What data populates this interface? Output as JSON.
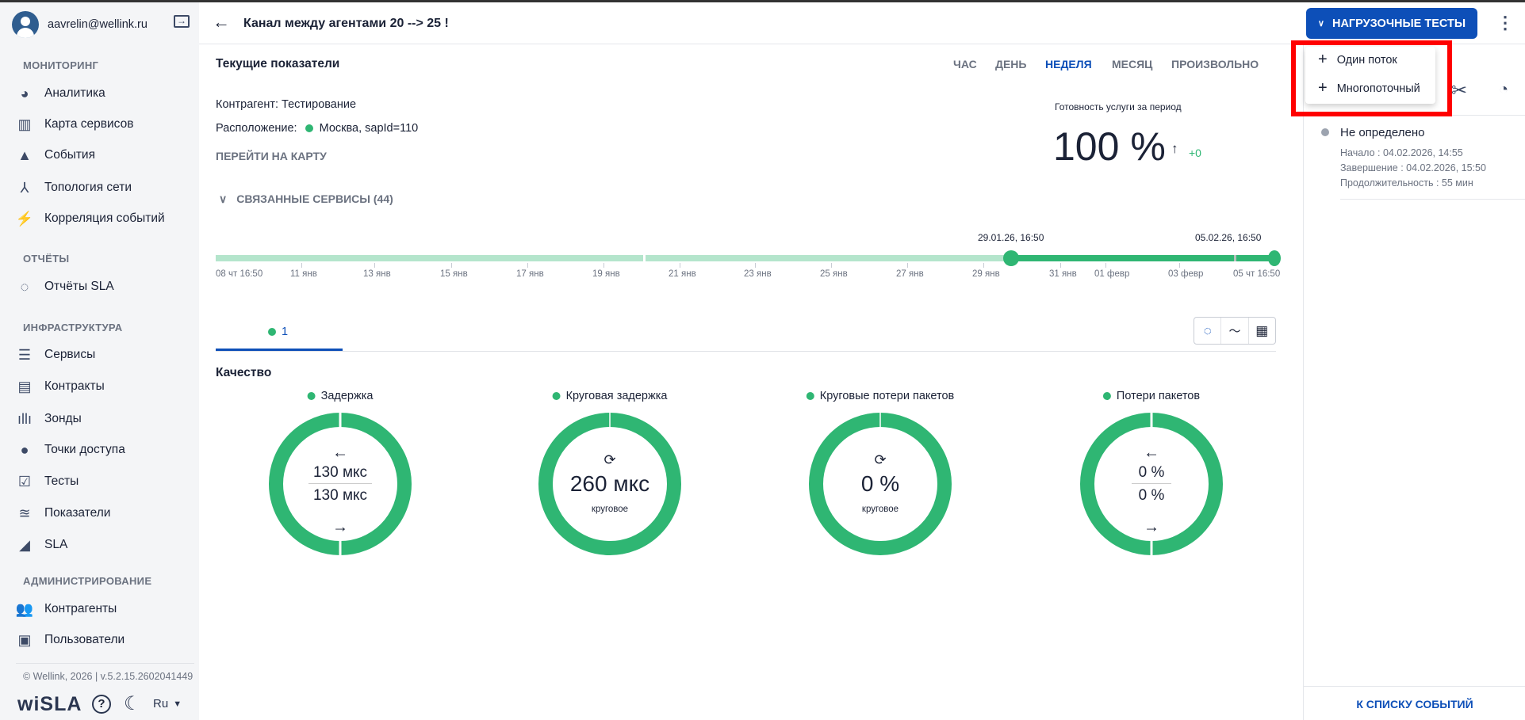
{
  "user": {
    "email": "aavrelin@wellink.ru"
  },
  "sidebar": {
    "sections": [
      "МОНИТОРИНГ",
      "ОТЧЁТЫ",
      "ИНФРАСТРУКТУРА",
      "АДМИНИСТРИРОВАНИЕ"
    ],
    "items": [
      {
        "label": "Аналитика",
        "icon": "pie-chart-icon"
      },
      {
        "label": "Карта сервисов",
        "icon": "map-icon"
      },
      {
        "label": "События",
        "icon": "warning-icon"
      },
      {
        "label": "Топология сети",
        "icon": "topology-icon"
      },
      {
        "label": "Корреляция событий",
        "icon": "bolt-icon"
      },
      {
        "label": "Отчёты SLA",
        "icon": "report-ring-icon"
      },
      {
        "label": "Сервисы",
        "icon": "list-icon"
      },
      {
        "label": "Контракты",
        "icon": "document-icon"
      },
      {
        "label": "Зонды",
        "icon": "probe-icon"
      },
      {
        "label": "Точки доступа",
        "icon": "access-point-icon"
      },
      {
        "label": "Тесты",
        "icon": "tests-icon"
      },
      {
        "label": "Показатели",
        "icon": "metrics-icon"
      },
      {
        "label": "SLA",
        "icon": "sla-icon"
      },
      {
        "label": "Контрагенты",
        "icon": "people-icon"
      },
      {
        "label": "Пользователи",
        "icon": "user-card-icon"
      }
    ],
    "footer": "© Wellink, 2026 | v.5.2.15.2602041449",
    "logo": "wiSLA",
    "lang": "Ru"
  },
  "header": {
    "title": "Канал между агентами 20 --> 25 !",
    "load_tests_button": "НАГРУЗОЧНЫЕ ТЕСТЫ"
  },
  "dropdown": {
    "items": [
      "Один поток",
      "Многопоточный"
    ]
  },
  "main": {
    "section_title": "Текущие показатели",
    "periods": [
      "ЧАС",
      "ДЕНЬ",
      "НЕДЕЛЯ",
      "МЕСЯЦ",
      "ПРОИЗВОЛЬНО"
    ],
    "active_period": "НЕДЕЛЯ",
    "counterparty": "Контрагент: Тестирование",
    "location_label": "Расположение:",
    "location_value": "Москва, sapId=110",
    "map_link": "ПЕРЕЙТИ НА КАРТУ",
    "readiness_label": "Готовность услуги за период",
    "readiness_value": "100 %",
    "readiness_delta": "+0",
    "related": "СВЯЗАННЫЕ СЕРВИСЫ (44)",
    "range_start": "29.01.26, 16:50",
    "range_end": "05.02.26, 16:50",
    "ticks": [
      "08 чт 16:50",
      "11 янв",
      "13 янв",
      "15 янв",
      "17 янв",
      "19 янв",
      "21 янв",
      "23 янв",
      "25 янв",
      "27 янв",
      "29 янв",
      "31 янв",
      "01 февр",
      "03 февр",
      "05 чт 16:50"
    ],
    "tab": "1",
    "quality_title": "Качество",
    "metrics": [
      {
        "name": "Задержка",
        "top": "130 мкс",
        "bottom": "130 мкс",
        "type": "bidir"
      },
      {
        "name": "Круговая задержка",
        "value": "260 мкс",
        "sub": "круговое",
        "type": "round"
      },
      {
        "name": "Круговые потери пакетов",
        "value": "0 %",
        "sub": "круговое",
        "type": "round"
      },
      {
        "name": "Потери пакетов",
        "top": "0 %",
        "bottom": "0 %",
        "type": "bidir"
      }
    ],
    "colors": {
      "ok": "#2fb673",
      "accent": "#0d4fb8"
    }
  },
  "events": {
    "status": "Не определено",
    "start": "Начало : 04.02.2026, 14:55",
    "end": "Завершение : 04.02.2026, 15:50",
    "duration": "Продолжительность : 55 мин",
    "list_link": "К СПИСКУ СОБЫТИЙ"
  }
}
